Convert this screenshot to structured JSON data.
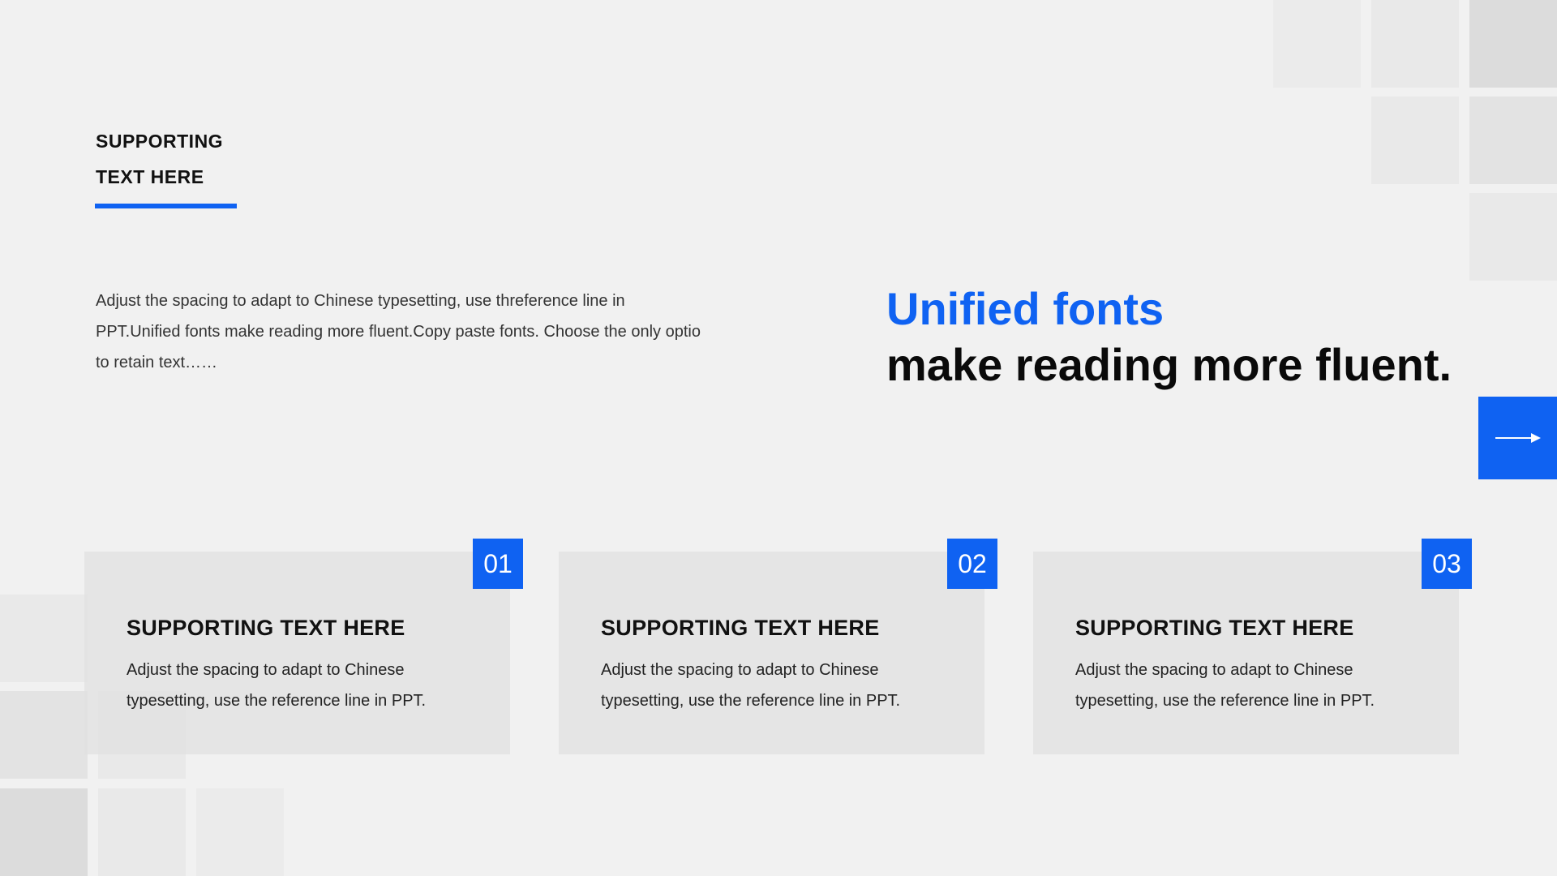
{
  "header": {
    "title_line1": "SUPPORTING",
    "title_line2": "TEXT HERE"
  },
  "intro": {
    "text": "Adjust the spacing to adapt to Chinese typesetting, use threference line in PPT.Unified fonts make reading more fluent.Copy paste fonts. Choose the only optio to retain text……"
  },
  "headline": {
    "accent": "Unified fonts",
    "main": "make reading more fluent."
  },
  "arrow_button": {
    "icon": "arrow-right-icon"
  },
  "cards": [
    {
      "number": "01",
      "title": "SUPPORTING TEXT HERE",
      "body": "Adjust the spacing to adapt to Chinese typesetting, use the reference line in PPT."
    },
    {
      "number": "02",
      "title": "SUPPORTING TEXT HERE",
      "body": "Adjust the spacing to adapt to Chinese typesetting, use the reference line in PPT."
    },
    {
      "number": "03",
      "title": "SUPPORTING TEXT HERE",
      "body": "Adjust the spacing to adapt to Chinese typesetting, use the reference line in PPT."
    }
  ],
  "colors": {
    "accent": "#0f62f2",
    "background": "#f1f1f1",
    "card": "#e4e4e4",
    "text": "#111111"
  }
}
